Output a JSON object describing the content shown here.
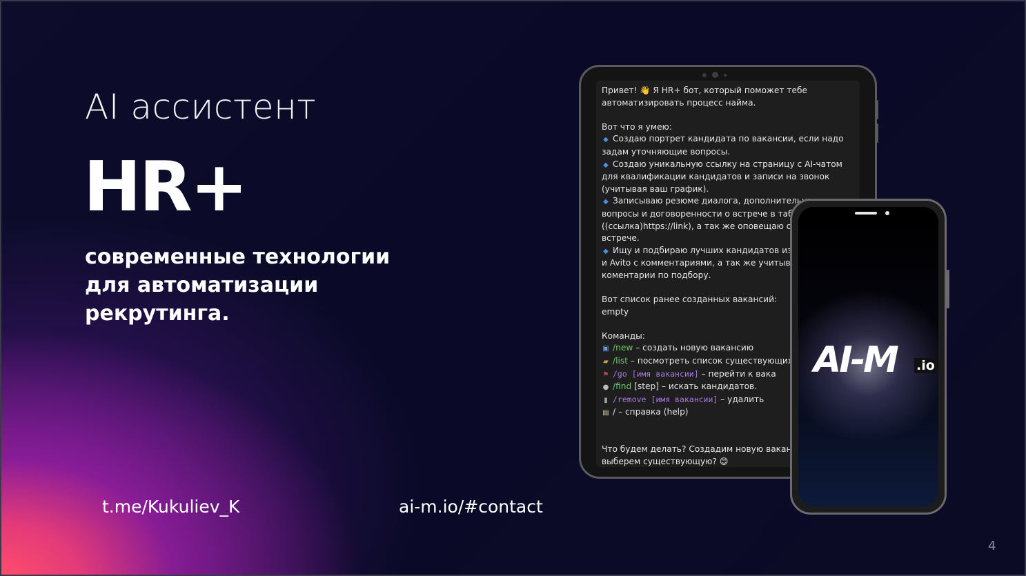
{
  "slide": {
    "subtitle": "AI ассистент",
    "title": "HR+",
    "tagline": "современные технологии для автоматизации рекрутинга.",
    "contact_telegram": "t.me/Kukuliev_K",
    "contact_site": "ai-m.io/#contact",
    "page_number": "4"
  },
  "tablet_chat": {
    "greeting_1": "Привет! 👋 Я HR+ бот, который поможет тебе",
    "greeting_2": "автоматизировать процесс найма.",
    "skills_header": "Вот что я умею:",
    "skill_1a": "Создаю портрет кандидата по вакансии, если надо",
    "skill_1b": "задам уточняющие вопросы.",
    "skill_2a": "Создаю уникальную ссылку на страницу с AI-чатом",
    "skill_2b": "для квалификации кандидатов и записи на звонок",
    "skill_2c": "(учитывая ваш график).",
    "skill_3a": "Записываю резюме диалога, дополнительные",
    "skill_3b": "вопросы и договоренности о встрече в табл",
    "skill_3c": "((ссылка)https://link), а так же оповещаю о",
    "skill_3d": "встрече.",
    "skill_4a": "Ищу и подбираю лучших кандидатов из",
    "skill_4b": "и Avito с комментариями, а так же учитыва",
    "skill_4c": "коментарии по подбору.",
    "vacancies_header": "Вот список ранее созданных вакансий:",
    "vacancies_value": "empty",
    "commands_header": "Команды:",
    "cmd_new": "/new",
    "cmd_new_desc": " – создать новую вакансию",
    "cmd_list": "/list",
    "cmd_list_desc": " – посмотреть список существующих",
    "cmd_go": "/go",
    "cmd_go_arg": " [имя вакансии]",
    "cmd_go_desc": " – перейти к вака",
    "cmd_find": "/find",
    "cmd_find_desc": " [step] – искать кандидатов.",
    "cmd_remove": "/remove",
    "cmd_remove_arg": " [имя вакансии]",
    "cmd_remove_desc": " – удалить",
    "cmd_help": "/ – справка (help)",
    "closing_1": "Что будем делать? Создадим новую ваканс",
    "closing_2": "выберем существующую? 😊"
  },
  "phone": {
    "logo_main": "AI-M",
    "logo_suffix": ".io"
  },
  "icons": {
    "bullet": "blue-diamond-icon",
    "new": "new-badge-icon",
    "list": "folder-icon",
    "go": "signpost-icon",
    "find": "magnifier-icon",
    "remove": "trash-icon",
    "help": "book-icon"
  },
  "colors": {
    "command_green": "#6fc76f",
    "command_purple": "#a77be0",
    "gradient_pink": "#ff4d6a",
    "gradient_purple": "#961ea0",
    "background": "#0b0b24"
  }
}
